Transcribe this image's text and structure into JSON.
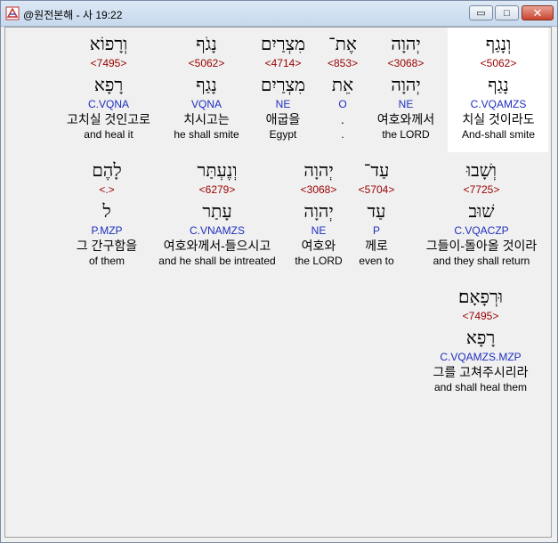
{
  "window": {
    "title": "@원전본해 - 사 19:22"
  },
  "controls": {
    "minimize": "▭",
    "maximize": "□",
    "close": "✕"
  },
  "row1": [
    {
      "heb": "וְנָגַף",
      "num": "<5062>",
      "lemma": "נָגַף",
      "morph": "C.VQAMZS",
      "kor": "치실 것이라도",
      "eng": "And-shall smite"
    },
    {
      "heb": "יְהוָה",
      "num": "<3068>",
      "lemma": "יְהוָה",
      "morph": "NE",
      "kor": "여호와께서",
      "eng": "the LORD"
    },
    {
      "heb": "אֶת־",
      "num": "<853>",
      "lemma": "אֵת",
      "morph": "O",
      "kor": ".",
      "eng": "."
    },
    {
      "heb": "מִצְרַיִם",
      "num": "<4714>",
      "lemma": "מִצְרַיִם",
      "morph": "NE",
      "kor": "애굽을",
      "eng": "Egypt"
    },
    {
      "heb": "נָגֹף",
      "num": "<5062>",
      "lemma": "נָגַף",
      "morph": "VQNA",
      "kor": "치시고는",
      "eng": "he shall smite"
    },
    {
      "heb": "וְרָפוֹא",
      "num": "<7495>",
      "lemma": "רָפָא",
      "morph": "C.VQNA",
      "kor": "고치실 것인고로",
      "eng": "and heal it"
    }
  ],
  "row2": [
    {
      "heb": "וְשָׁבוּ",
      "num": "<7725>",
      "lemma": "שׁוּב",
      "morph": "C.VQACZP",
      "kor": "그들이-돌아올 것이라",
      "eng": "and they shall return"
    },
    {
      "heb": "עַד־",
      "num": "<5704>",
      "lemma": "עַד",
      "morph": "P",
      "kor": "께로",
      "eng": "even to"
    },
    {
      "heb": "יְהוָה",
      "num": "<3068>",
      "lemma": "יְהוָה",
      "morph": "NE",
      "kor": "여호와",
      "eng": "the LORD"
    },
    {
      "heb": "וְנֶעְתַּר",
      "num": "<6279>",
      "lemma": "עָתַר",
      "morph": "C.VNAMZS",
      "kor": "여호와께서-들으시고",
      "eng": "and he shall be intreated"
    },
    {
      "heb": "לָהֶם",
      "num": "<.>",
      "lemma": "ל",
      "morph": "P.MZP",
      "kor": "그 간구함을",
      "eng": "of them"
    }
  ],
  "row3": [
    {
      "heb": "וּרְפָאָם׃",
      "num": "<7495>",
      "lemma": "רָפָא",
      "morph": "C.VQAMZS.MZP",
      "kor": "그를 고쳐주시리라",
      "eng": "and shall heal them"
    }
  ]
}
